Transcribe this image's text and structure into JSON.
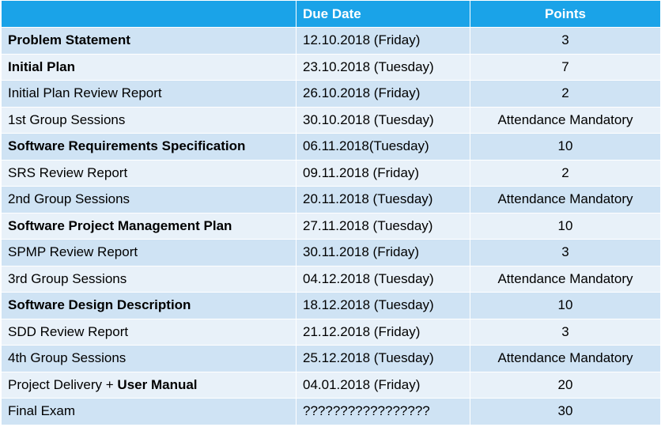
{
  "header": {
    "task": "",
    "due_date": "Due Date",
    "points": "Points"
  },
  "rows": [
    {
      "task": "Problem Statement",
      "task_bold": true,
      "due_date": "12.10.2018 (Friday)",
      "points": "3"
    },
    {
      "task": "Initial Plan",
      "task_bold": true,
      "due_date": "23.10.2018 (Tuesday)",
      "points": "7"
    },
    {
      "task": "Initial Plan Review Report",
      "task_bold": false,
      "due_date": "26.10.2018 (Friday)",
      "points": "2"
    },
    {
      "task": "1st Group Sessions",
      "task_bold": false,
      "due_date": "30.10.2018 (Tuesday)",
      "points": "Attendance Mandatory"
    },
    {
      "task": "Software Requirements Specification",
      "task_bold": true,
      "due_date": "06.11.2018(Tuesday)",
      "points": "10"
    },
    {
      "task": "SRS Review Report",
      "task_bold": false,
      "due_date": "09.11.2018 (Friday)",
      "points": "2"
    },
    {
      "task": "2nd Group Sessions",
      "task_bold": false,
      "due_date": "20.11.2018 (Tuesday)",
      "points": "Attendance Mandatory"
    },
    {
      "task": "Software Project Management Plan",
      "task_bold": true,
      "due_date": "27.11.2018 (Tuesday)",
      "points": "10"
    },
    {
      "task": "SPMP Review Report",
      "task_bold": false,
      "due_date": "30.11.2018 (Friday)",
      "points": "3"
    },
    {
      "task": "3rd Group Sessions",
      "task_bold": false,
      "due_date": "04.12.2018 (Tuesday)",
      "points": "Attendance Mandatory"
    },
    {
      "task": "Software Design Description",
      "task_bold": true,
      "due_date": "18.12.2018 (Tuesday)",
      "points": "10"
    },
    {
      "task": "SDD Review Report",
      "task_bold": false,
      "due_date": "21.12.2018 (Friday)",
      "points": "3"
    },
    {
      "task": "4th Group Sessions",
      "task_bold": false,
      "due_date": "25.12.2018 (Tuesday)",
      "points": "Attendance Mandatory"
    },
    {
      "task_prefix": "Project Delivery + ",
      "task_bold_part": "User Manual",
      "due_date": "04.01.2018 (Friday)",
      "points": "20"
    },
    {
      "task": "Final Exam",
      "task_bold": false,
      "due_date": "?????????????????",
      "points": "30"
    }
  ],
  "colors": {
    "header_bg": "#1aa3e8",
    "header_text": "#ffffff",
    "row_odd": "#cfe3f4",
    "row_even": "#e8f1f9",
    "border": "#ffffff"
  }
}
